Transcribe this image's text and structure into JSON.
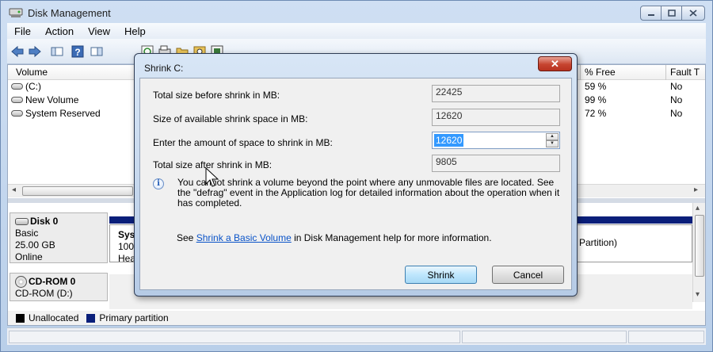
{
  "window": {
    "title": "Disk Management",
    "caption_buttons": [
      "minimize",
      "maximize",
      "close"
    ]
  },
  "menu": [
    "File",
    "Action",
    "View",
    "Help"
  ],
  "volume_list": {
    "columns": [
      "Volume",
      "% Free",
      "Fault T"
    ],
    "rows": [
      {
        "volume": "(C:)",
        "free": "59 %",
        "fault": "No"
      },
      {
        "volume": "New Volume",
        "free": "99 %",
        "fault": "No"
      },
      {
        "volume": "System Reserved",
        "free": "72 %",
        "fault": "No"
      }
    ]
  },
  "disks": [
    {
      "name": "Disk 0",
      "type": "Basic",
      "size": "25.00 GB",
      "status": "Online"
    },
    {
      "name": "CD-ROM 0",
      "type": "CD-ROM (D:)"
    }
  ],
  "partition": {
    "line1": "Syst",
    "line2": "100",
    "line3": "Hea",
    "right_text": "Partition)"
  },
  "legend": [
    {
      "label": "Unallocated",
      "color": "#000000"
    },
    {
      "label": "Primary partition",
      "color": "#0a1f7a"
    }
  ],
  "dialog": {
    "title": "Shrink C:",
    "close_label": "✕",
    "fields": [
      {
        "label": "Total size before shrink in MB:",
        "value": "22425"
      },
      {
        "label": "Size of available shrink space in MB:",
        "value": "12620"
      },
      {
        "label": "Enter the amount of space to shrink in MB:",
        "value": "12620"
      },
      {
        "label": "Total size after shrink in MB:",
        "value": "9805"
      }
    ],
    "info_text": "You cannot shrink a volume beyond the point where any unmovable files are located. See the \"defrag\" event in the Application log for detailed information about the operation when it has completed.",
    "help_prefix": "See ",
    "help_link": "Shrink a Basic Volume",
    "help_suffix": " in Disk Management help for more information.",
    "shrink_label": "Shrink",
    "cancel_label": "Cancel"
  }
}
